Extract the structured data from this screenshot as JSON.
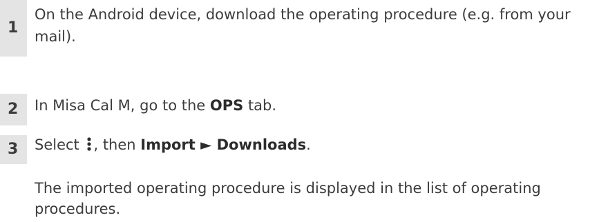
{
  "steps": [
    {
      "number": "1",
      "text": "On the Android device, download the operating procedure (e.g. from your mail)."
    },
    {
      "number": "2",
      "text_before": "In Misa Cal M, go to the ",
      "bold": "OPS",
      "text_after": " tab."
    },
    {
      "number": "3",
      "text_before": "Select ",
      "icon": "more-vert-icon",
      "text_mid": ", then ",
      "bold_1": "Import",
      "arrow": " ► ",
      "bold_2": "Downloads",
      "text_after": "."
    }
  ],
  "result": "The imported operating procedure is displayed in the list of operating procedures."
}
